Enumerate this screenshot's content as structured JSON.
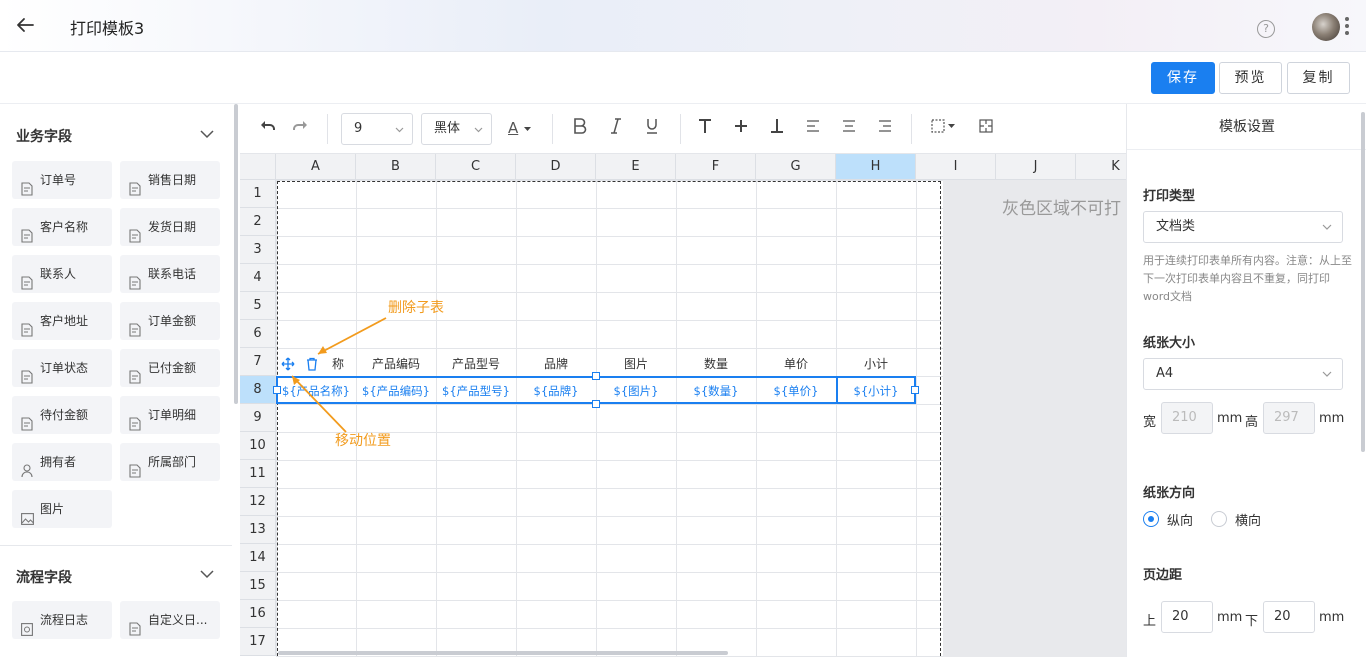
{
  "header": {
    "title": "打印模板3",
    "help_icon": "?"
  },
  "actions": {
    "save": "保存",
    "preview": "预览",
    "copy": "复制"
  },
  "sidebar": {
    "business_title": "业务字段",
    "business_fields": [
      "订单号",
      "销售日期",
      "客户名称",
      "发货日期",
      "联系人",
      "联系电话",
      "客户地址",
      "订单金额",
      "订单状态",
      "已付金额",
      "待付金额",
      "订单明细",
      "拥有者",
      "所属部门",
      "图片"
    ],
    "business_icons": [
      "doc-icon",
      "doc-icon",
      "doc-icon",
      "doc-icon",
      "doc-icon",
      "doc-icon",
      "doc-icon",
      "doc-icon",
      "doc-icon",
      "doc-icon",
      "doc-icon",
      "doc-icon",
      "user-icon",
      "doc-icon",
      "image-icon"
    ],
    "process_title": "流程字段",
    "process_fields": [
      "流程日志",
      "自定义日..."
    ],
    "process_icons": [
      "log-icon",
      "doc-icon"
    ]
  },
  "toolbar": {
    "font_size": "9",
    "font_family": "黑体",
    "font_color_glyph": "A",
    "font_color": "#333333"
  },
  "sheet": {
    "columns": [
      "A",
      "B",
      "C",
      "D",
      "E",
      "F",
      "G",
      "H",
      "I",
      "J",
      "K"
    ],
    "selected_column": "H",
    "rows": [
      "1",
      "2",
      "3",
      "4",
      "5",
      "6",
      "7",
      "8",
      "9",
      "10",
      "11",
      "12",
      "13",
      "14",
      "15",
      "16",
      "17"
    ],
    "selected_row": "8",
    "header_cells": [
      "称",
      "产品编码",
      "产品型号",
      "品牌",
      "图片",
      "数量",
      "单价",
      "小计"
    ],
    "var_cells": [
      "${产品名称}",
      "${产品编码}",
      "${产品型号}",
      "${品牌}",
      "${图片}",
      "${数量}",
      "${单价}",
      "${小计}"
    ],
    "grey_notice": "灰色区域不可打",
    "annotation_delete": "删除子表",
    "annotation_move": "移动位置",
    "accent_color": "#1a7ff0",
    "annotation_color": "#f29b1d"
  },
  "panel": {
    "title": "模板设置",
    "print_type_label": "打印类型",
    "print_type_value": "文档类",
    "print_type_desc": "用于连续打印表单所有内容。注意：从上至下一次打印表单内容且不重复，同打印word文档",
    "paper_size_label": "纸张大小",
    "paper_size_value": "A4",
    "width_label": "宽",
    "width_value": "210",
    "height_label": "高",
    "height_value": "297",
    "unit": "mm",
    "orientation_label": "纸张方向",
    "orientation_portrait": "纵向",
    "orientation_landscape": "横向",
    "margin_label": "页边距",
    "margin_top_label": "上",
    "margin_top_value": "20",
    "margin_bottom_label": "下",
    "margin_bottom_value": "20"
  }
}
